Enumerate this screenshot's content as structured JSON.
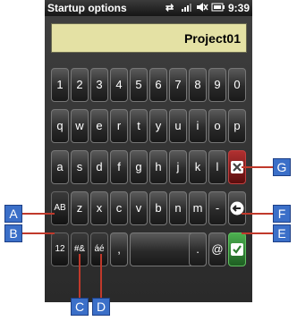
{
  "statusbar": {
    "title": "Startup options",
    "time": "9:39"
  },
  "field": {
    "value": "Project01"
  },
  "keys": {
    "row1": [
      "1",
      "2",
      "3",
      "4",
      "5",
      "6",
      "7",
      "8",
      "9",
      "0"
    ],
    "row2": [
      "q",
      "w",
      "e",
      "r",
      "t",
      "y",
      "u",
      "i",
      "o",
      "p"
    ],
    "row3": [
      "a",
      "s",
      "d",
      "f",
      "g",
      "h",
      "j",
      "k",
      "l"
    ],
    "row4": [
      "AB",
      "z",
      "x",
      "c",
      "v",
      "b",
      "n",
      "m",
      "-"
    ],
    "row5": {
      "mode12": "12",
      "symbols": "#&",
      "accents": "áé",
      "comma": ",",
      "period": ".",
      "at": "@"
    }
  },
  "callouts": {
    "a": "A",
    "b": "B",
    "c": "C",
    "d": "D",
    "e": "E",
    "f": "F",
    "g": "G"
  },
  "colors": {
    "callout": "#3b6fc8",
    "field_bg": "#e4e1a4",
    "delete_key": "#8b1a1a",
    "enter_key": "#2f7d32"
  }
}
